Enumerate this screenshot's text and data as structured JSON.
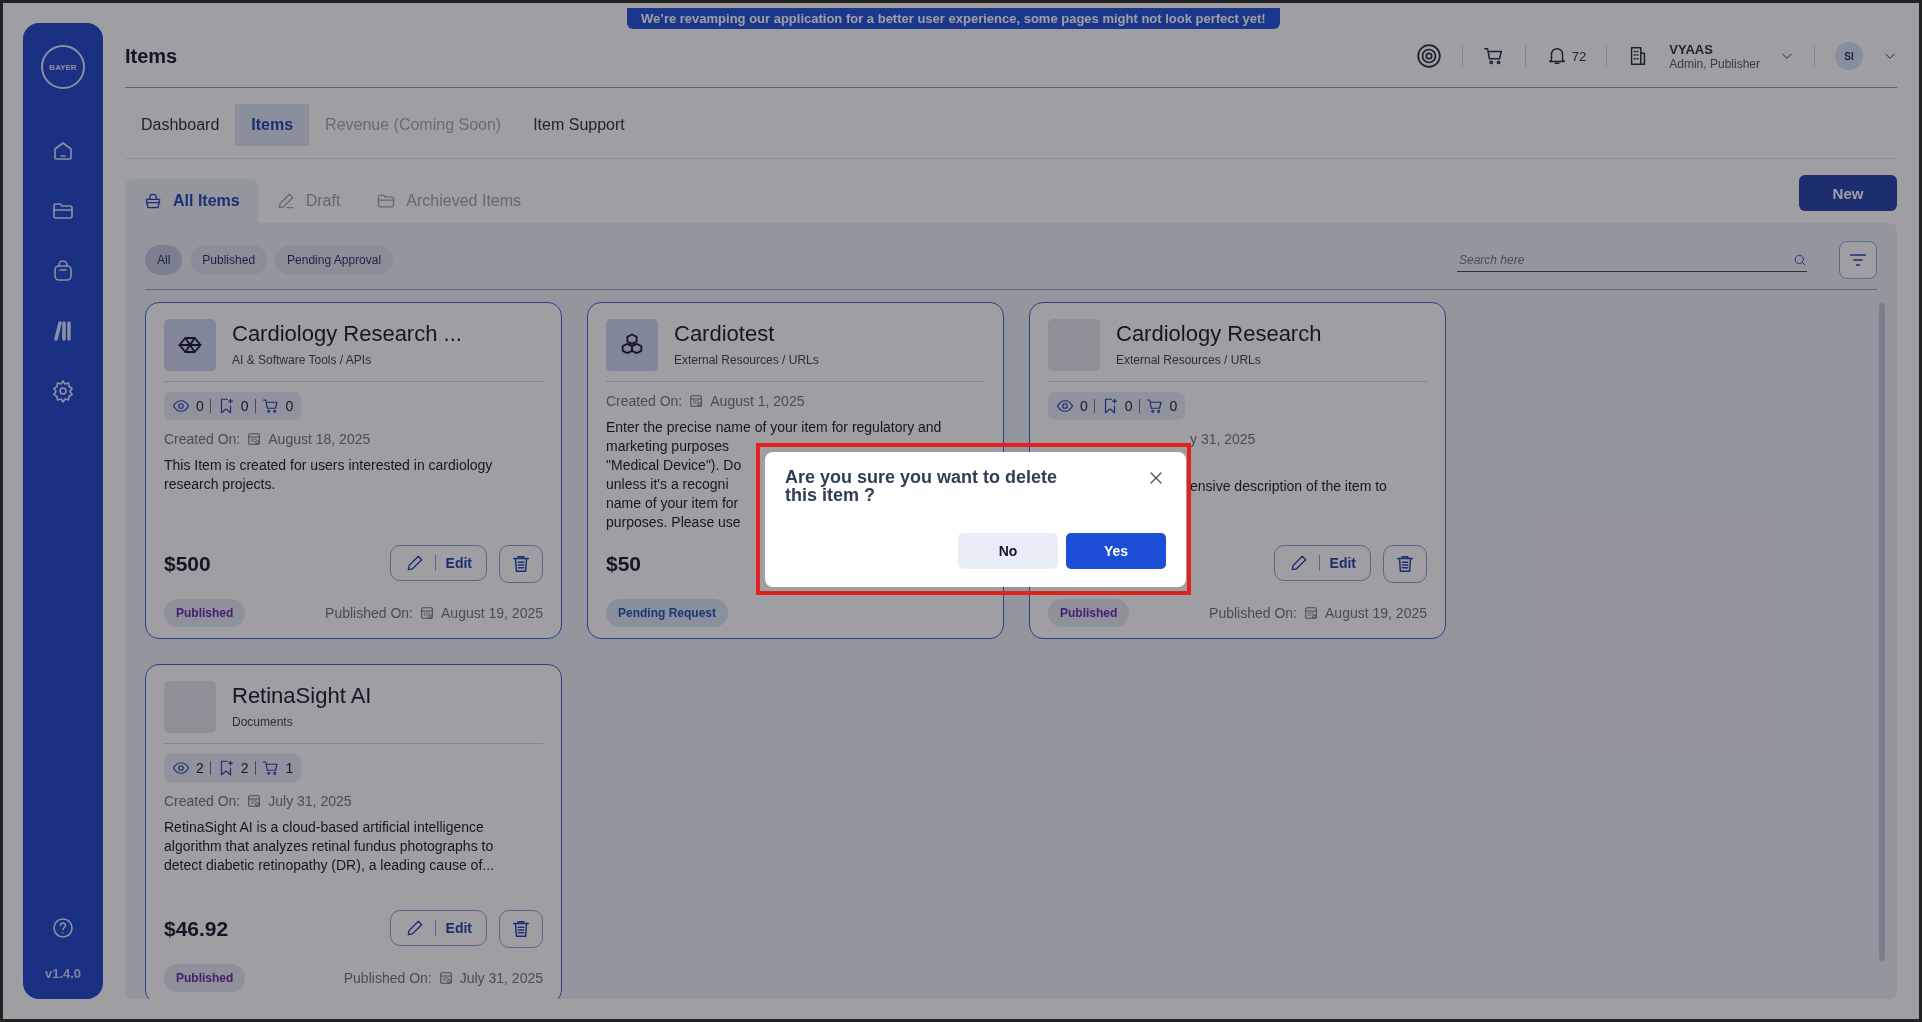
{
  "banner": "We’re revamping our application for a better user experience, some pages might not look perfect yet!",
  "sidebar": {
    "logo": "BAYER",
    "version": "v1.4.0"
  },
  "header": {
    "title": "Items",
    "notifications": "72",
    "user_name": "VYAAS",
    "user_role": "Admin, Publisher",
    "avatar": "SI"
  },
  "nav_tabs": [
    {
      "label": "Dashboard",
      "selected": false,
      "disabled": false
    },
    {
      "label": "Items",
      "selected": true,
      "disabled": false
    },
    {
      "label": "Revenue (Coming Soon)",
      "selected": false,
      "disabled": true
    },
    {
      "label": "Item Support",
      "selected": false,
      "disabled": false
    }
  ],
  "sub_tabs": [
    {
      "label": "All Items",
      "selected": true
    },
    {
      "label": "Draft",
      "selected": false
    },
    {
      "label": "Archieved Items",
      "selected": false
    }
  ],
  "new_button": "New",
  "filters": [
    {
      "label": "All",
      "selected": true
    },
    {
      "label": "Published",
      "selected": false
    },
    {
      "label": "Pending Approval",
      "selected": false
    }
  ],
  "search": {
    "placeholder": "Search here"
  },
  "cards": [
    {
      "title": "Cardiology Research ...",
      "category": "AI & Software Tools / APIs",
      "kind": "icon",
      "stats": {
        "views": "0",
        "saves": "0",
        "carts": "0"
      },
      "created": {
        "label": "Created On:",
        "date": "August 18, 2025"
      },
      "description": {
        "lines": [
          "This Item is created for users interested in cardiology",
          "research projects."
        ]
      },
      "price": "$500",
      "actions": {
        "edit": "Edit"
      },
      "status": {
        "label": "Published",
        "kind": "published"
      },
      "published": {
        "label": "Published On:",
        "date": "August 19, 2025"
      }
    },
    {
      "title": "Cardiotest",
      "category": "External Resources / URLs",
      "kind": "icon",
      "created": {
        "label": "Created On:",
        "date": "August 1, 2025"
      },
      "description": {
        "lines": [
          "Enter the precise name of your item for regulatory and",
          "marketing purposes",
          "\"Medical Device\"). Do",
          "unless it's a recogni",
          "name of your item for",
          "purposes. Please use"
        ]
      },
      "price": "$50",
      "status": {
        "label": "Pending Request",
        "kind": "pending"
      }
    },
    {
      "title": "Cardiology Research",
      "category": "External Resources / URLs",
      "kind": "blank",
      "stats": {
        "views": "0",
        "saves": "0",
        "carts": "0"
      },
      "created": {
        "date": "y 31, 2025",
        "cut_start": true
      },
      "description": {
        "lines": [
          "ensive description of the item to"
        ],
        "cut_start": true
      },
      "actions": {
        "edit": "Edit"
      },
      "status": {
        "label": "Published",
        "kind": "published"
      },
      "published": {
        "label": "Published On:",
        "date": "August 19, 2025"
      }
    },
    {
      "title": "RetinaSight AI",
      "category": "Documents",
      "kind": "blank",
      "stats": {
        "views": "2",
        "saves": "2",
        "carts": "1"
      },
      "created": {
        "label": "Created On:",
        "date": "July 31, 2025"
      },
      "description": {
        "lines": [
          "RetinaSight AI is a cloud-based artificial intelligence",
          "algorithm that analyzes retinal fundus photographs to",
          "detect diabetic retinopathy (DR), a leading cause of..."
        ]
      },
      "price": "$46.92",
      "actions": {
        "edit": "Edit"
      },
      "status": {
        "label": "Published",
        "kind": "published"
      },
      "published": {
        "label": "Published On:",
        "date": "July 31, 2025"
      }
    }
  ],
  "dialog": {
    "title": "Are you sure you want to delete this item ?",
    "buttons": [
      {
        "label": "No",
        "kind": "secondary"
      },
      {
        "label": "Yes",
        "kind": "primary"
      }
    ],
    "highlighted": true
  }
}
